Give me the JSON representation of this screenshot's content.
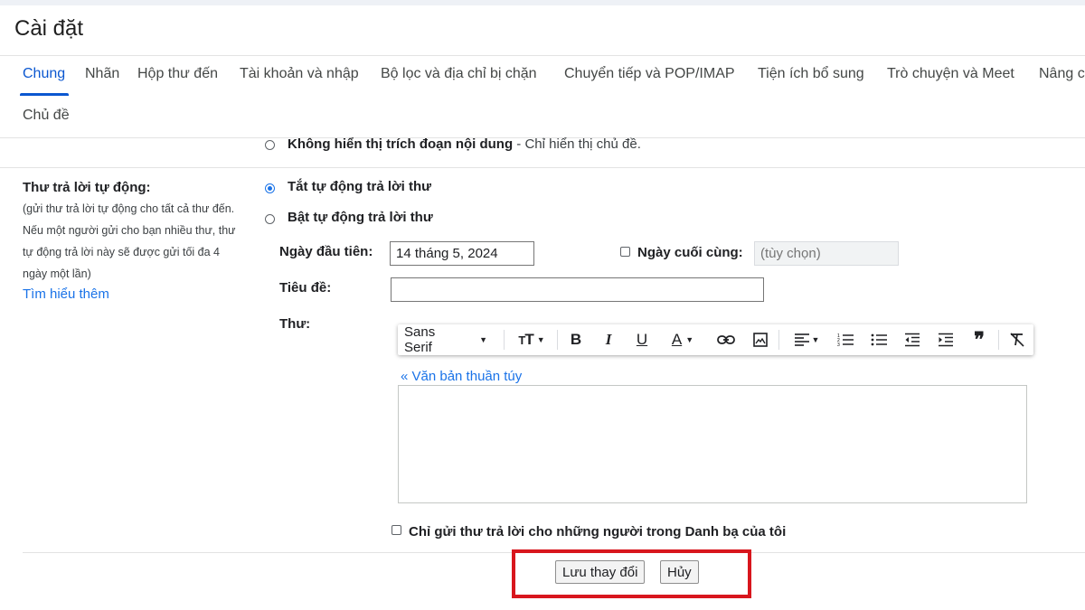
{
  "page": {
    "title": "Cài đặt"
  },
  "tabs": [
    {
      "label": "Chung",
      "active": true
    },
    {
      "label": "Nhãn"
    },
    {
      "label": "Hộp thư đến"
    },
    {
      "label": "Tài khoản và nhập"
    },
    {
      "label": "Bộ lọc và địa chỉ bị chặn"
    },
    {
      "label": "Chuyển tiếp và POP/IMAP"
    },
    {
      "label": "Tiện ích bổ sung"
    },
    {
      "label": "Trò chuyện và Meet"
    },
    {
      "label": "Nâng c"
    },
    {
      "label": "Chủ đề"
    }
  ],
  "snippets": {
    "option_bold": "Không hiển thị trích đoạn nội dung",
    "option_desc": " - Chỉ hiển thị chủ đề."
  },
  "autoreply": {
    "heading": "Thư trả lời tự động:",
    "description_lines": [
      "(gửi thư trả lời tự động cho tất cả thư đến.",
      "Nếu một người gửi cho bạn nhiều thư, thư",
      "tự động trả lời này sẽ được gửi tối đa 4",
      "ngày một lần)"
    ],
    "learn_more": "Tìm hiểu thêm",
    "off_label": "Tắt tự động trả lời thư",
    "on_label": "Bật tự động trả lời thư",
    "selected": "off",
    "first_day_label": "Ngày đầu tiên:",
    "first_day_value": "14 tháng 5, 2024",
    "last_day_label": "Ngày cuối cùng:",
    "last_day_placeholder": "(tùy chọn)",
    "subject_label": "Tiêu đề:",
    "subject_value": "",
    "message_label": "Thư:",
    "plain_text_link": "« Văn bản thuần túy",
    "contacts_only_label": "Chỉ gửi thư trả lời cho những người trong Danh bạ của tôi"
  },
  "toolbar": {
    "font": "Sans Serif",
    "icons": [
      "font-size-icon",
      "bold-icon",
      "italic-icon",
      "underline-icon",
      "text-color-icon",
      "link-icon",
      "image-icon",
      "align-icon",
      "numbered-list-icon",
      "bulleted-list-icon",
      "indent-less-icon",
      "indent-more-icon",
      "quote-icon",
      "remove-formatting-icon"
    ]
  },
  "buttons": {
    "save": "Lưu thay đổi",
    "cancel": "Hủy"
  },
  "colors": {
    "accent": "#0b57d0",
    "link": "#1a73e8",
    "highlight": "#d8161d"
  }
}
